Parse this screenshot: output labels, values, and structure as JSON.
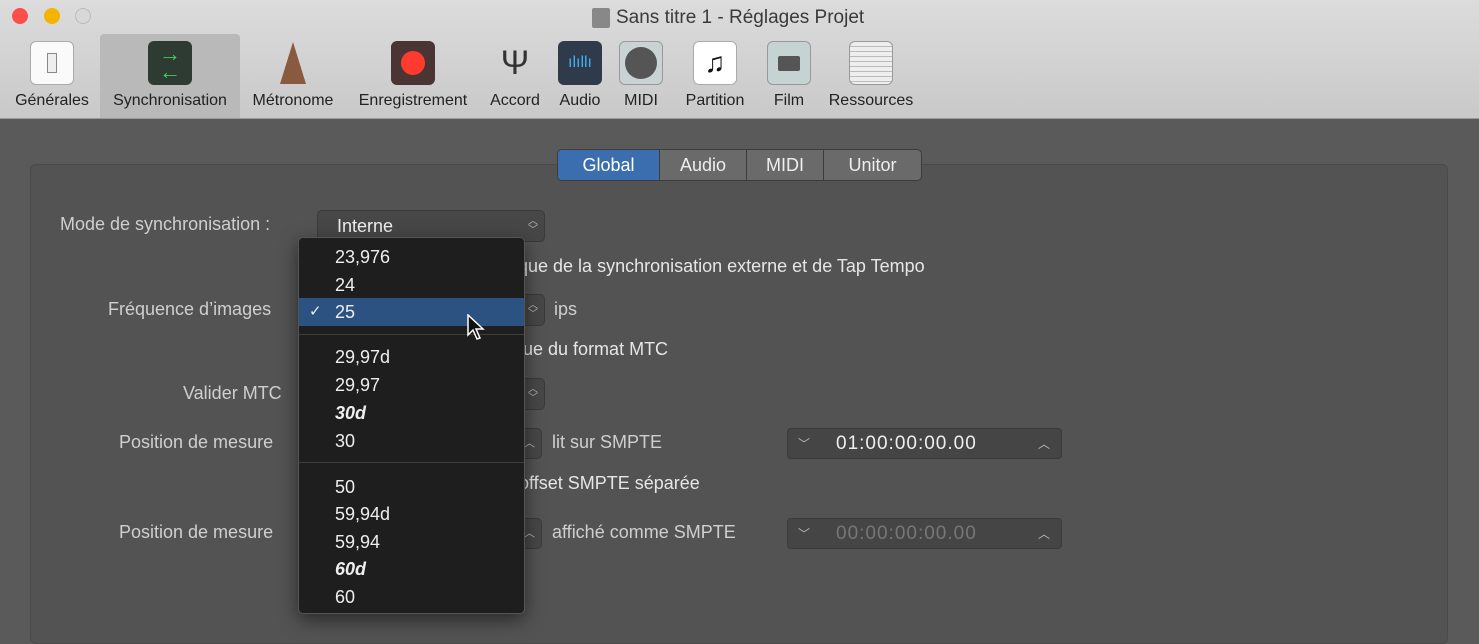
{
  "window": {
    "title": "Sans titre 1 - Réglages Projet"
  },
  "toolbar": [
    {
      "label": "Générales",
      "icon": "switch-icon"
    },
    {
      "label": "Synchronisation",
      "icon": "sync-arrows-icon",
      "selected": true
    },
    {
      "label": "Métronome",
      "icon": "metronome-icon"
    },
    {
      "label": "Enregistrement",
      "icon": "record-icon"
    },
    {
      "label": "Accord",
      "icon": "tuning-fork-icon"
    },
    {
      "label": "Audio",
      "icon": "waveform-icon"
    },
    {
      "label": "MIDI",
      "icon": "midi-port-icon"
    },
    {
      "label": "Partition",
      "icon": "music-note-icon"
    },
    {
      "label": "Film",
      "icon": "video-camera-icon"
    },
    {
      "label": "Ressources",
      "icon": "briefcase-icon"
    }
  ],
  "tabs": [
    {
      "label": "Global",
      "active": true
    },
    {
      "label": "Audio"
    },
    {
      "label": "MIDI"
    },
    {
      "label": "Unitor"
    }
  ],
  "form": {
    "sync_mode_label": "Mode de synchronisation :",
    "sync_mode_value": "Interne",
    "checkbox1_text": "ique de la synchronisation externe et de Tap Tempo",
    "frame_rate_label": "Fréquence d’images",
    "frame_rate_unit": "ips",
    "checkbox2_text": "que du format MTC",
    "validate_mtc_label": "Valider MTC",
    "position1_label": "Position de mesure",
    "position1_suffix": "lit sur SMPTE",
    "position1_smpte": "01:00:00:00.00",
    "checkbox3_text": "offset SMPTE séparée",
    "position2_label": "Position de mesure",
    "position2_suffix": "affiché comme SMPTE",
    "position2_smpte": "00:00:00:00.00"
  },
  "frame_rate_menu": {
    "checkmark": "✓",
    "groups": [
      [
        {
          "label": "23,976"
        },
        {
          "label": "24"
        },
        {
          "label": "25",
          "selected": true
        }
      ],
      [
        {
          "label": "29,97d"
        },
        {
          "label": "29,97"
        },
        {
          "label": "30d",
          "emphasis": true
        },
        {
          "label": "30"
        }
      ],
      [
        {
          "label": "50"
        },
        {
          "label": "59,94d"
        },
        {
          "label": "59,94"
        },
        {
          "label": "60d",
          "emphasis": true
        },
        {
          "label": "60"
        }
      ]
    ]
  }
}
